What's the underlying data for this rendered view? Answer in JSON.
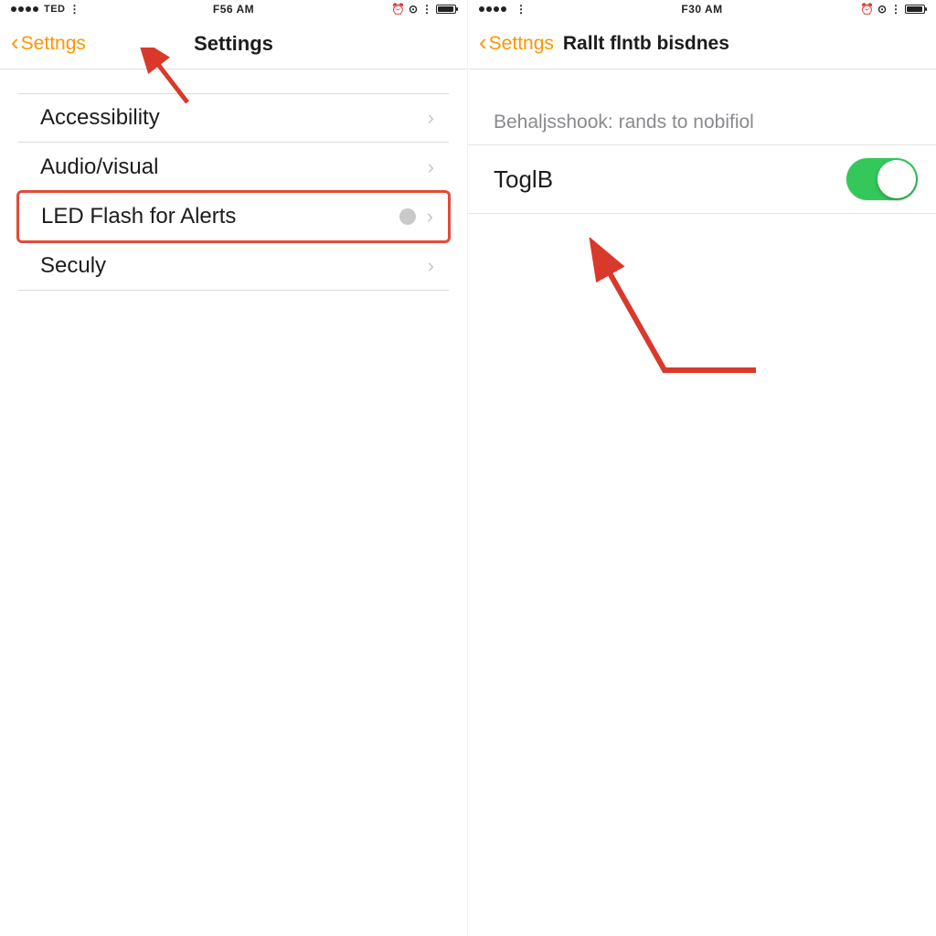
{
  "left": {
    "status": {
      "carrier": "TED",
      "time": "F56 AM",
      "right_icons": [
        "alarm",
        "timer",
        "wifi",
        "battery"
      ]
    },
    "nav": {
      "back": "Settngs",
      "title": "Settings"
    },
    "rows": [
      {
        "label": "Accessibility",
        "highlighted": false,
        "has_dot": false
      },
      {
        "label": "Audio/visual",
        "highlighted": false,
        "has_dot": false
      },
      {
        "label": "LED Flash for Alerts",
        "highlighted": true,
        "has_dot": true
      },
      {
        "label": "Seculy",
        "highlighted": false,
        "has_dot": false
      }
    ]
  },
  "right": {
    "status": {
      "carrier": "",
      "time": "F30 AM",
      "right_icons": [
        "alarm",
        "timer",
        "wifi",
        "battery"
      ]
    },
    "nav": {
      "back": "Settngs",
      "title": "Rallt flntb bisdnes"
    },
    "section_header": "Behaljsshook: rands to nobifiol",
    "toggle": {
      "label": "ToglB",
      "on": true
    }
  },
  "colors": {
    "accent": "#ff9500",
    "highlight": "#e14b3a",
    "switch_on": "#34c759"
  }
}
